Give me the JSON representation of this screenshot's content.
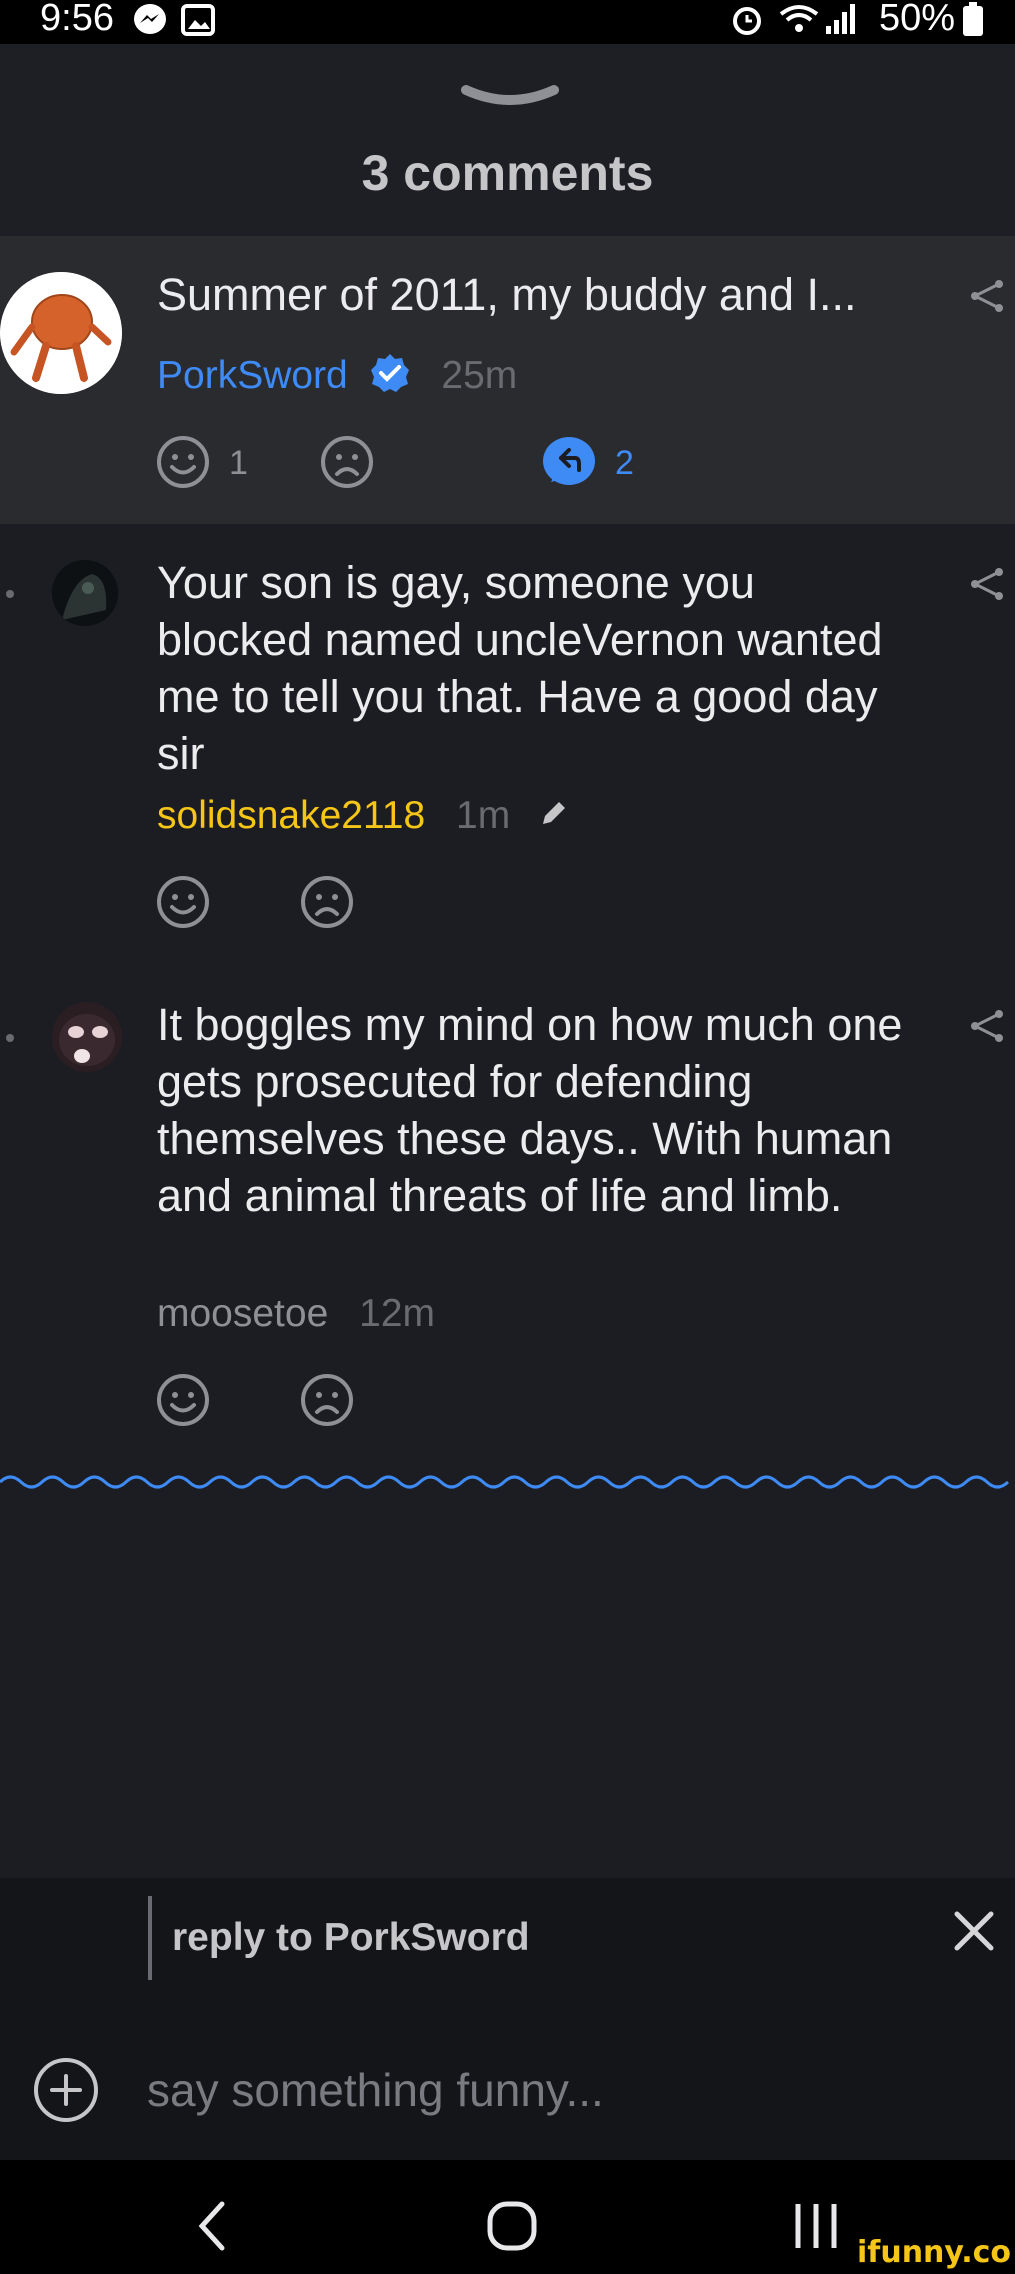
{
  "status_bar": {
    "time": "9:56",
    "battery": "50%",
    "icons": [
      "messenger-icon",
      "gallery-icon",
      "alarm-icon",
      "wifi-icon",
      "signal-icon",
      "battery-icon"
    ]
  },
  "sheet": {
    "title": "3 comments"
  },
  "comments": [
    {
      "text": "Summer of 2011, my buddy and I...",
      "author": "PorkSword",
      "verified": true,
      "time": "25m",
      "smile_count": "1",
      "reply_count": "2"
    },
    {
      "text": "Your son is gay, someone you blocked named uncleVernon wanted me to tell you that. Have a good day sir",
      "author": "solidsnake2118",
      "time": "1m",
      "edited": true
    },
    {
      "text": "It boggles my mind on how much one gets prosecuted for defending themselves these days.. With human and animal threats of life and limb.",
      "author": "moosetoe",
      "time": "12m"
    }
  ],
  "reply_bar": {
    "label": "reply to PorkSword",
    "placeholder": "say something funny..."
  },
  "watermark": "ifunny.co",
  "colors": {
    "background": "#1c1d22",
    "highlight": "#2a2b2f",
    "accent_blue": "#3f8bf5",
    "gold": "#f5c518"
  }
}
